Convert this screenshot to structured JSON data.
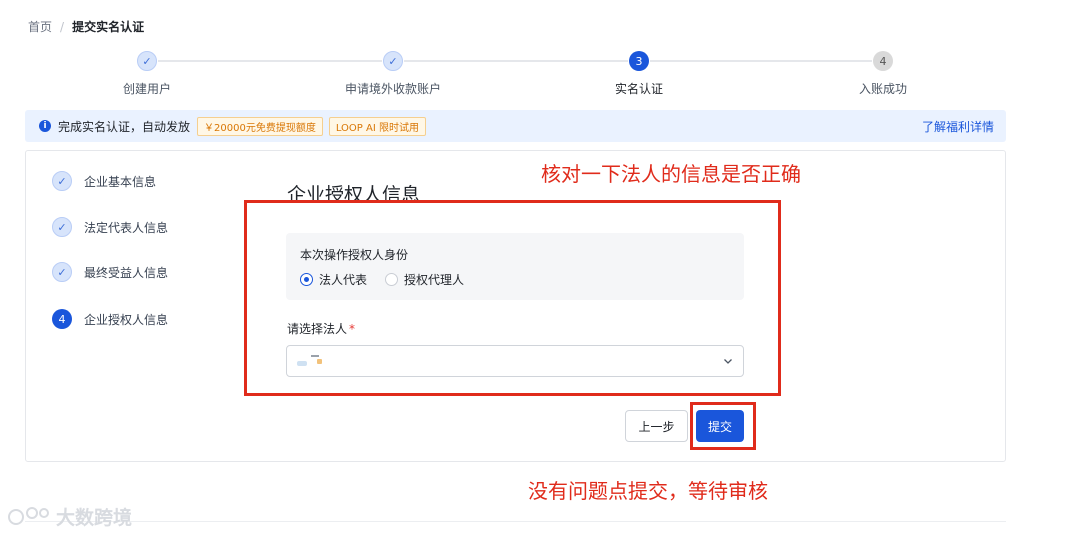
{
  "breadcrumb": {
    "home": "首页",
    "separator": "/",
    "current": "提交实名认证"
  },
  "stepper": {
    "steps": [
      {
        "label": "创建用户",
        "status": "done",
        "index": "1"
      },
      {
        "label": "申请境外收款账户",
        "status": "done",
        "index": "2"
      },
      {
        "label": "实名认证",
        "status": "active",
        "index": "3"
      },
      {
        "label": "入账成功",
        "status": "pending",
        "index": "4"
      }
    ]
  },
  "banner": {
    "text": "完成实名认证，自动发放",
    "tags": [
      "￥20000元免费提现额度",
      "LOOP AI 限时试用"
    ],
    "link": "了解福利详情"
  },
  "side_steps": [
    {
      "label": "企业基本信息",
      "status": "done",
      "index": "1"
    },
    {
      "label": "法定代表人信息",
      "status": "done",
      "index": "2"
    },
    {
      "label": "最终受益人信息",
      "status": "done",
      "index": "3"
    },
    {
      "label": "企业授权人信息",
      "status": "active",
      "index": "4"
    }
  ],
  "form": {
    "title": "企业授权人信息",
    "role_label": "本次操作授权人身份",
    "role_options": [
      {
        "label": "法人代表",
        "checked": true
      },
      {
        "label": "授权代理人",
        "checked": false
      }
    ],
    "select_label": "请选择法人",
    "required_mark": "*",
    "prev_button": "上一步",
    "submit_button": "提交"
  },
  "annotations": {
    "top": "核对一下法人的信息是否正确",
    "bottom": "没有问题点提交，等待审核",
    "color": "#e02b1b"
  },
  "watermark": "大数跨境",
  "colors": {
    "primary": "#1a56db",
    "banner_bg": "#eaf2ff",
    "tag_text": "#d97706"
  }
}
